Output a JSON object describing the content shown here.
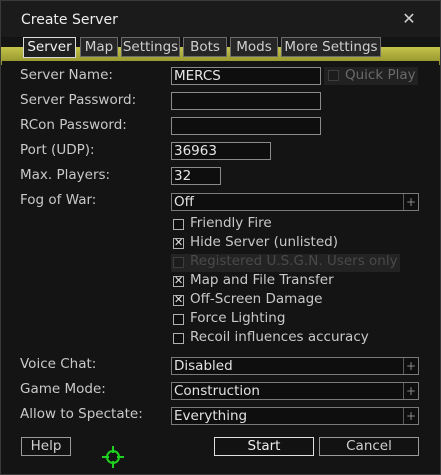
{
  "window": {
    "title": "Create Server",
    "close_glyph": "✕"
  },
  "tabs": [
    {
      "label": "Server",
      "active": true
    },
    {
      "label": "Map",
      "active": false
    },
    {
      "label": "Settings",
      "active": false
    },
    {
      "label": "Bots",
      "active": false
    },
    {
      "label": "Mods",
      "active": false
    },
    {
      "label": "More Settings",
      "active": false
    }
  ],
  "fields": {
    "server_name": {
      "label": "Server Name:",
      "value": "MERCS"
    },
    "quick_play": {
      "label": "Quick Play",
      "checked": false,
      "enabled": false
    },
    "server_password": {
      "label": "Server Password:",
      "value": ""
    },
    "rcon_password": {
      "label": "RCon Password:",
      "value": ""
    },
    "port": {
      "label": "Port (UDP):",
      "value": "36963"
    },
    "max_players": {
      "label": "Max. Players:",
      "value": "32"
    },
    "fog_of_war": {
      "label": "Fog of War:",
      "value": "Off"
    }
  },
  "checkboxes": [
    {
      "label": "Friendly Fire",
      "checked": false,
      "enabled": true
    },
    {
      "label": "Hide Server (unlisted)",
      "checked": true,
      "enabled": true
    },
    {
      "label": "Registered U.S.G.N. Users only",
      "checked": false,
      "enabled": false
    },
    {
      "label": "Map and File Transfer",
      "checked": true,
      "enabled": true
    },
    {
      "label": "Off-Screen Damage",
      "checked": true,
      "enabled": true
    },
    {
      "label": "Force Lighting",
      "checked": false,
      "enabled": true
    },
    {
      "label": "Recoil influences accuracy",
      "checked": false,
      "enabled": true
    }
  ],
  "selects": {
    "voice_chat": {
      "label": "Voice Chat:",
      "value": "Disabled"
    },
    "game_mode": {
      "label": "Game Mode:",
      "value": "Construction"
    },
    "allow_spectate": {
      "label": "Allow to Spectate:",
      "value": "Everything"
    },
    "plus_glyph": "+"
  },
  "buttons": {
    "help": "Help",
    "start": "Start",
    "cancel": "Cancel"
  },
  "check_glyph": "✕",
  "colors": {
    "accent_yellow": "#c3c34a",
    "crosshair_green": "#1fd21f"
  }
}
